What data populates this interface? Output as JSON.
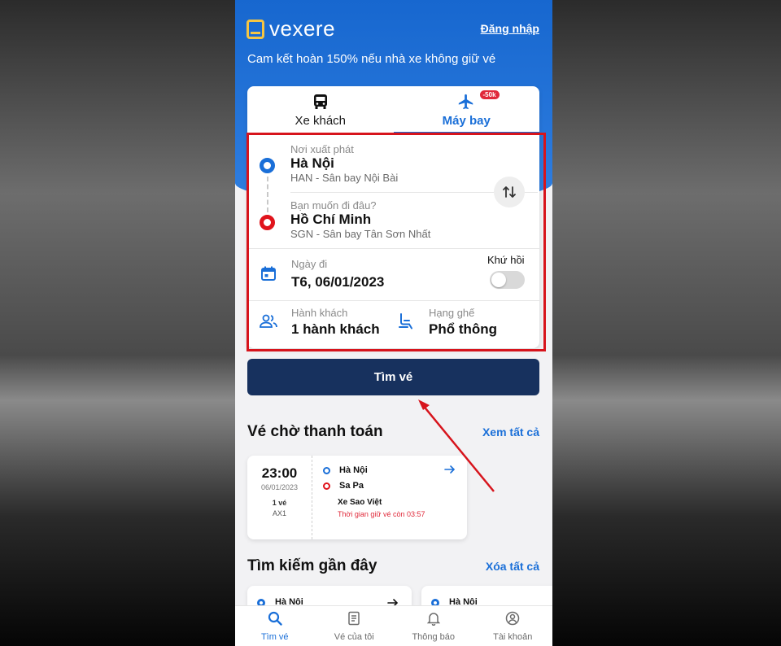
{
  "header": {
    "logo_text": "vexere",
    "login_label": "Đăng nhập",
    "promise": "Cam kết hoàn 150% nếu nhà xe không giữ vé"
  },
  "tabs": [
    {
      "label": "Xe khách",
      "icon": "bus-icon",
      "active": false
    },
    {
      "label": "Máy bay",
      "icon": "airplane-icon",
      "active": true,
      "badge": "-50k"
    }
  ],
  "form": {
    "from": {
      "label": "Nơi xuất phát",
      "value": "Hà Nội",
      "sub": "HAN - Sân bay Nội Bài"
    },
    "to": {
      "label": "Bạn muốn đi đâu?",
      "value": "Hồ Chí Minh",
      "sub": "SGN - Sân bay Tân Sơn Nhất"
    },
    "date": {
      "label": "Ngày đi",
      "value": "T6, 06/01/2023"
    },
    "round_trip": {
      "label": "Khứ hồi",
      "enabled": false
    },
    "passengers": {
      "label": "Hành khách",
      "value": "1 hành khách"
    },
    "seat_class": {
      "label": "Hạng ghế",
      "value": "Phổ thông"
    },
    "search_label": "Tìm vé"
  },
  "pending": {
    "title": "Vé chờ thanh toán",
    "view_all": "Xem tất cả",
    "ticket": {
      "time": "23:00",
      "date": "06/01/2023",
      "count": "1 vé",
      "code": "AX1",
      "from": "Hà Nội",
      "to": "Sa Pa",
      "operator": "Xe Sao Việt",
      "hold_text": "Thời gian giữ vé còn 03:57"
    }
  },
  "recent": {
    "title": "Tìm kiếm gần đây",
    "clear": "Xóa tất cả",
    "items": [
      {
        "from": "Hà Nội"
      },
      {
        "from": "Hà Nội"
      }
    ]
  },
  "tabbar": [
    {
      "label": "Tìm vé",
      "icon": "search-icon",
      "active": true
    },
    {
      "label": "Vé của tôi",
      "icon": "ticket-icon",
      "active": false
    },
    {
      "label": "Thông báo",
      "icon": "bell-icon",
      "active": false
    },
    {
      "label": "Tài khoản",
      "icon": "account-icon",
      "active": false
    }
  ],
  "colors": {
    "primary": "#1a6fd8",
    "header_blue": "#1767cf",
    "button_navy": "#17315e",
    "alert_red": "#e0141c",
    "logo_yellow": "#f5c542"
  }
}
